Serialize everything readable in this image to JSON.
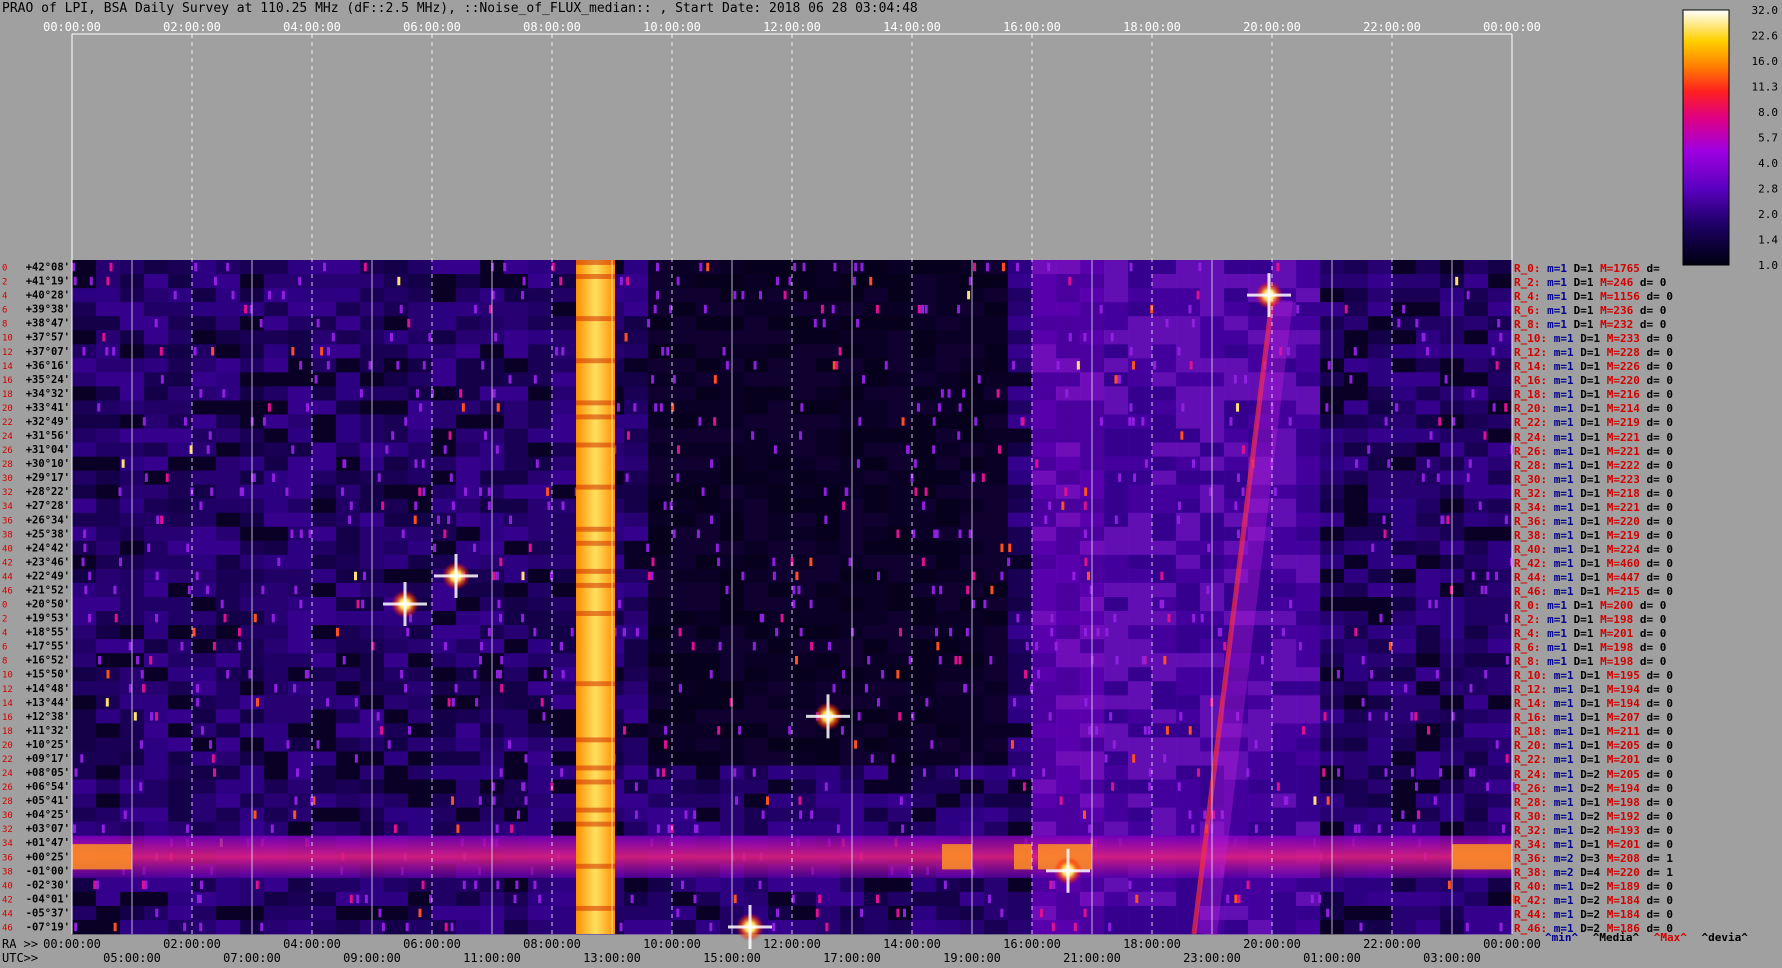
{
  "title": "PRAO of LPI, BSA Daily Survey at 110.25 MHz (dF::2.5 MHz), ::Noise_of_FLUX_median:: , Start Date: 2018 06 28 03:04:48",
  "chart_data": {
    "type": "heatmap",
    "top_axis_ticks": [
      "00:00:00",
      "02:00:00",
      "04:00:00",
      "06:00:00",
      "08:00:00",
      "10:00:00",
      "12:00:00",
      "14:00:00",
      "16:00:00",
      "18:00:00",
      "20:00:00",
      "22:00:00",
      "00:00:00"
    ],
    "ra_axis_label": "RA >>",
    "ra_ticks": [
      "00:00:00",
      "02:00:00",
      "04:00:00",
      "06:00:00",
      "08:00:00",
      "10:00:00",
      "12:00:00",
      "14:00:00",
      "16:00:00",
      "18:00:00",
      "20:00:00",
      "22:00:00",
      "00:00:00"
    ],
    "utc_axis_label": "UTC>>",
    "utc_ticks": [
      "05:00:00",
      "07:00:00",
      "09:00:00",
      "11:00:00",
      "13:00:00",
      "15:00:00",
      "17:00:00",
      "19:00:00",
      "21:00:00",
      "23:00:00",
      "01:00:00",
      "03:00:00"
    ],
    "colorbar_ticks": [
      "32.0",
      "22.6",
      "16.0",
      "11.3",
      "8.0",
      "5.7",
      "4.0",
      "2.8",
      "2.0",
      "1.4",
      "1.0"
    ],
    "declinations": [
      "+42°08'",
      "+41°19'",
      "+40°28'",
      "+39°38'",
      "+38°47'",
      "+37°57'",
      "+37°07'",
      "+36°16'",
      "+35°24'",
      "+34°32'",
      "+33°41'",
      "+32°49'",
      "+31°56'",
      "+31°04'",
      "+30°10'",
      "+29°17'",
      "+28°22'",
      "+27°28'",
      "+26°34'",
      "+25°38'",
      "+24°42'",
      "+23°46'",
      "+22°49'",
      "+21°52'",
      "+20°50'",
      "+19°53'",
      "+18°55'",
      "+17°55'",
      "+16°52'",
      "+15°50'",
      "+14°48'",
      "+13°44'",
      "+12°38'",
      "+11°32'",
      "+10°25'",
      "+09°17'",
      "+08°05'",
      "+06°54'",
      "+05°41'",
      "+04°25'",
      "+03°07'",
      "+01°47'",
      "+00°25'",
      "-01°00'",
      "-02°30'",
      "-04°01'",
      "-05°37'",
      "-07°19'"
    ],
    "beam_numbers": [
      "0",
      "2",
      "4",
      "6",
      "8",
      "10",
      "12",
      "14",
      "16",
      "18",
      "20",
      "22",
      "24",
      "26",
      "28",
      "30",
      "32",
      "34",
      "36",
      "38",
      "40",
      "42",
      "44",
      "46",
      "0",
      "2",
      "4",
      "6",
      "8",
      "10",
      "12",
      "14",
      "16",
      "18",
      "20",
      "22",
      "24",
      "26",
      "28",
      "30",
      "32",
      "34",
      "36",
      "38",
      "40",
      "42",
      "44",
      "46"
    ],
    "legend_rows": [
      {
        "id": "R_0:",
        "m": "m=1",
        "d": "D=1",
        "M": "M=1765",
        "dv": "d="
      },
      {
        "id": "R_2:",
        "m": "m=1",
        "d": "D=1",
        "M": "M=246",
        "dv": "d= 0"
      },
      {
        "id": "R_4:",
        "m": "m=1",
        "d": "D=1",
        "M": "M=1156",
        "dv": "d= 0"
      },
      {
        "id": "R_6:",
        "m": "m=1",
        "d": "D=1",
        "M": "M=236",
        "dv": "d= 0"
      },
      {
        "id": "R_8:",
        "m": "m=1",
        "d": "D=1",
        "M": "M=232",
        "dv": "d= 0"
      },
      {
        "id": "R_10:",
        "m": "m=1",
        "d": "D=1",
        "M": "M=233",
        "dv": "d= 0"
      },
      {
        "id": "R_12:",
        "m": "m=1",
        "d": "D=1",
        "M": "M=228",
        "dv": "d= 0"
      },
      {
        "id": "R_14:",
        "m": "m=1",
        "d": "D=1",
        "M": "M=226",
        "dv": "d= 0"
      },
      {
        "id": "R_16:",
        "m": "m=1",
        "d": "D=1",
        "M": "M=220",
        "dv": "d= 0"
      },
      {
        "id": "R_18:",
        "m": "m=1",
        "d": "D=1",
        "M": "M=216",
        "dv": "d= 0"
      },
      {
        "id": "R_20:",
        "m": "m=1",
        "d": "D=1",
        "M": "M=214",
        "dv": "d= 0"
      },
      {
        "id": "R_22:",
        "m": "m=1",
        "d": "D=1",
        "M": "M=219",
        "dv": "d= 0"
      },
      {
        "id": "R_24:",
        "m": "m=1",
        "d": "D=1",
        "M": "M=221",
        "dv": "d= 0"
      },
      {
        "id": "R_26:",
        "m": "m=1",
        "d": "D=1",
        "M": "M=221",
        "dv": "d= 0"
      },
      {
        "id": "R_28:",
        "m": "m=1",
        "d": "D=1",
        "M": "M=222",
        "dv": "d= 0"
      },
      {
        "id": "R_30:",
        "m": "m=1",
        "d": "D=1",
        "M": "M=223",
        "dv": "d= 0"
      },
      {
        "id": "R_32:",
        "m": "m=1",
        "d": "D=1",
        "M": "M=218",
        "dv": "d= 0"
      },
      {
        "id": "R_34:",
        "m": "m=1",
        "d": "D=1",
        "M": "M=221",
        "dv": "d= 0"
      },
      {
        "id": "R_36:",
        "m": "m=1",
        "d": "D=1",
        "M": "M=220",
        "dv": "d= 0"
      },
      {
        "id": "R_38:",
        "m": "m=1",
        "d": "D=1",
        "M": "M=219",
        "dv": "d= 0"
      },
      {
        "id": "R_40:",
        "m": "m=1",
        "d": "D=1",
        "M": "M=224",
        "dv": "d= 0"
      },
      {
        "id": "R_42:",
        "m": "m=1",
        "d": "D=1",
        "M": "M=460",
        "dv": "d= 0"
      },
      {
        "id": "R_44:",
        "m": "m=1",
        "d": "D=1",
        "M": "M=447",
        "dv": "d= 0"
      },
      {
        "id": "R_46:",
        "m": "m=1",
        "d": "D=1",
        "M": "M=215",
        "dv": "d= 0"
      },
      {
        "id": "R_0:",
        "m": "m=1",
        "d": "D=1",
        "M": "M=200",
        "dv": "d= 0"
      },
      {
        "id": "R_2:",
        "m": "m=1",
        "d": "D=1",
        "M": "M=198",
        "dv": "d= 0"
      },
      {
        "id": "R_4:",
        "m": "m=1",
        "d": "D=1",
        "M": "M=201",
        "dv": "d= 0"
      },
      {
        "id": "R_6:",
        "m": "m=1",
        "d": "D=1",
        "M": "M=198",
        "dv": "d= 0"
      },
      {
        "id": "R_8:",
        "m": "m=1",
        "d": "D=1",
        "M": "M=198",
        "dv": "d= 0"
      },
      {
        "id": "R_10:",
        "m": "m=1",
        "d": "D=1",
        "M": "M=195",
        "dv": "d= 0"
      },
      {
        "id": "R_12:",
        "m": "m=1",
        "d": "D=1",
        "M": "M=194",
        "dv": "d= 0"
      },
      {
        "id": "R_14:",
        "m": "m=1",
        "d": "D=1",
        "M": "M=194",
        "dv": "d= 0"
      },
      {
        "id": "R_16:",
        "m": "m=1",
        "d": "D=1",
        "M": "M=207",
        "dv": "d= 0"
      },
      {
        "id": "R_18:",
        "m": "m=1",
        "d": "D=1",
        "M": "M=211",
        "dv": "d= 0"
      },
      {
        "id": "R_20:",
        "m": "m=1",
        "d": "D=1",
        "M": "M=205",
        "dv": "d= 0"
      },
      {
        "id": "R_22:",
        "m": "m=1",
        "d": "D=1",
        "M": "M=201",
        "dv": "d= 0"
      },
      {
        "id": "R_24:",
        "m": "m=1",
        "d": "D=2",
        "M": "M=205",
        "dv": "d= 0"
      },
      {
        "id": "R_26:",
        "m": "m=1",
        "d": "D=2",
        "M": "M=194",
        "dv": "d= 0"
      },
      {
        "id": "R_28:",
        "m": "m=1",
        "d": "D=1",
        "M": "M=198",
        "dv": "d= 0"
      },
      {
        "id": "R_30:",
        "m": "m=1",
        "d": "D=2",
        "M": "M=192",
        "dv": "d= 0"
      },
      {
        "id": "R_32:",
        "m": "m=1",
        "d": "D=2",
        "M": "M=193",
        "dv": "d= 0"
      },
      {
        "id": "R_34:",
        "m": "m=1",
        "d": "D=1",
        "M": "M=201",
        "dv": "d= 0"
      },
      {
        "id": "R_36:",
        "m": "m=2",
        "d": "D=3",
        "M": "M=208",
        "dv": "d= 1"
      },
      {
        "id": "R_38:",
        "m": "m=2",
        "d": "D=4",
        "M": "M=220",
        "dv": "d= 1"
      },
      {
        "id": "R_40:",
        "m": "m=1",
        "d": "D=2",
        "M": "M=189",
        "dv": "d= 0"
      },
      {
        "id": "R_42:",
        "m": "m=1",
        "d": "D=2",
        "M": "M=184",
        "dv": "d= 0"
      },
      {
        "id": "R_44:",
        "m": "m=1",
        "d": "D=2",
        "M": "M=184",
        "dv": "d= 0"
      },
      {
        "id": "R_46:",
        "m": "m=1",
        "d": "D=2",
        "M": "M=186",
        "dv": "d= 0"
      }
    ],
    "footer_legend": {
      "min": "^min^",
      "median": "^Media^",
      "max": "^Max^",
      "deviation": "^devia^"
    },
    "features": {
      "vertical_band_ra_h": [
        8.4,
        9.05
      ],
      "horizontal_band_beams": [
        41,
        44
      ],
      "bright_sources": [
        {
          "ra_h": 6.4,
          "beam": 22
        },
        {
          "ra_h": 5.55,
          "beam": 24
        },
        {
          "ra_h": 19.95,
          "beam": 2
        },
        {
          "ra_h": 12.6,
          "beam": 32
        },
        {
          "ra_h": 11.3,
          "beam": 47
        },
        {
          "ra_h": 16.6,
          "beam": 43
        }
      ],
      "diagonal_track": {
        "start": {
          "ra_h": 18.7,
          "beam": 47
        },
        "end": {
          "ra_h": 20.0,
          "beam": 0
        }
      }
    },
    "colors": {
      "background": "#a0a0a0",
      "axis": "#ffffff",
      "dashed_grid": "#ffffff",
      "legend_red": "#d40000",
      "legend_blue": "#000090"
    }
  }
}
